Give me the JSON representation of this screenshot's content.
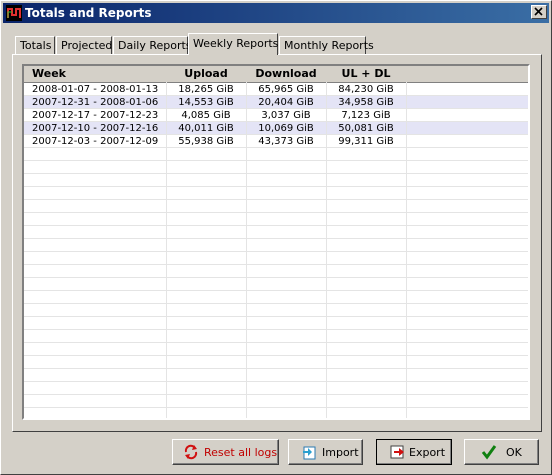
{
  "window": {
    "title": "Totals and Reports"
  },
  "tabs": [
    {
      "label": "Totals"
    },
    {
      "label": "Projected"
    },
    {
      "label": "Daily Reports"
    },
    {
      "label": "Weekly Reports",
      "active": true
    },
    {
      "label": "Monthly Reports"
    }
  ],
  "table": {
    "columns": [
      "Week",
      "Upload",
      "Download",
      "UL + DL"
    ],
    "rows": [
      [
        "2008-01-07 - 2008-01-13",
        "18,265 GiB",
        "65,965 GiB",
        "84,230 GiB"
      ],
      [
        "2007-12-31 - 2008-01-06",
        "14,553 GiB",
        "20,404 GiB",
        "34,958 GiB"
      ],
      [
        "2007-12-17 - 2007-12-23",
        "4,085 GiB",
        "3,037 GiB",
        "7,123 GiB"
      ],
      [
        "2007-12-10 - 2007-12-16",
        "40,011 GiB",
        "10,069 GiB",
        "50,081 GiB"
      ],
      [
        "2007-12-03 - 2007-12-09",
        "55,938 GiB",
        "43,373 GiB",
        "99,311 GiB"
      ]
    ]
  },
  "buttons": {
    "reset": {
      "label": "Reset all logs",
      "icon": "reset-arrows-icon",
      "color": "#c00000"
    },
    "import": {
      "label": "Import",
      "icon": "import-icon"
    },
    "export": {
      "label": "Export",
      "icon": "export-arrow-icon"
    },
    "ok": {
      "label": "OK",
      "icon": "checkmark-icon"
    }
  },
  "colors": {
    "title_bar_start": "#0a246a",
    "title_bar_end": "#3a6ea5",
    "row_alt": "#e4e4f6",
    "face": "#d4d0c8"
  }
}
